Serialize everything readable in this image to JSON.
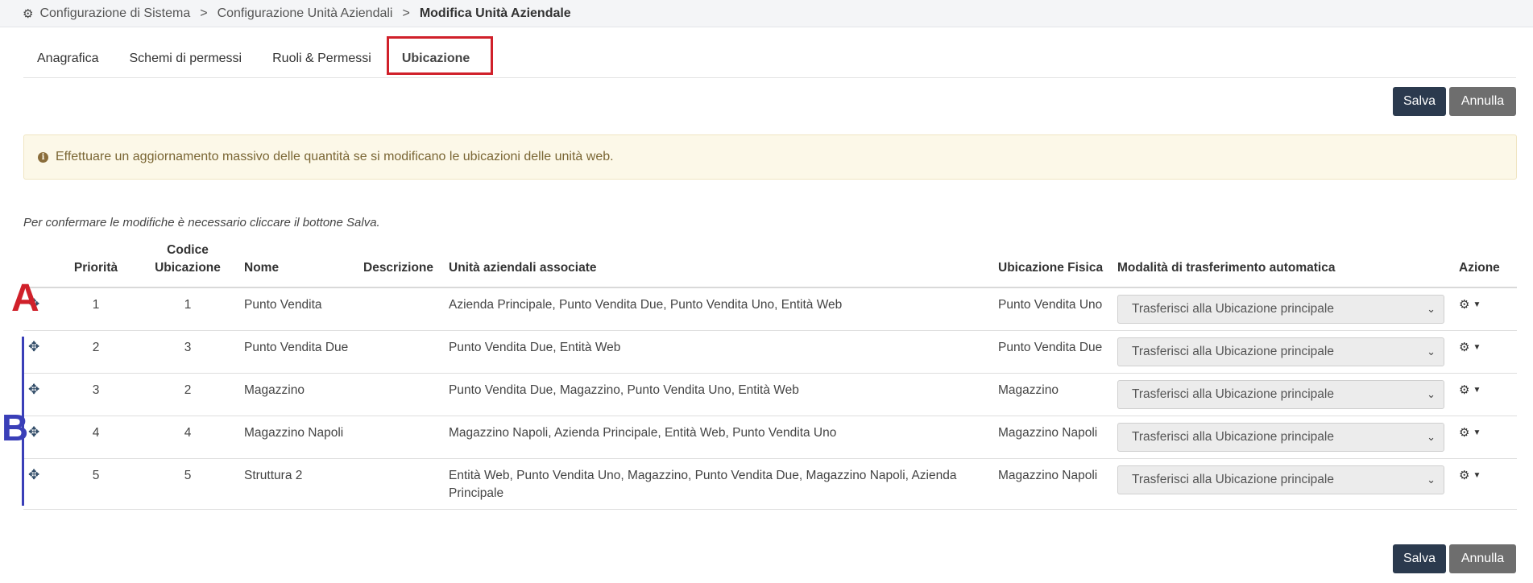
{
  "breadcrumb": {
    "icon": "cogs-icon",
    "items": [
      "Configurazione di Sistema",
      "Configurazione Unità Aziendali"
    ],
    "separator": ">",
    "current": "Modifica Unità Aziendale"
  },
  "tabs": [
    {
      "label": "Anagrafica",
      "active": false
    },
    {
      "label": "Schemi di permessi",
      "active": false
    },
    {
      "label": "Ruoli & Permessi",
      "active": false
    },
    {
      "label": "Ubicazione",
      "active": true
    }
  ],
  "buttons": {
    "save": "Salva",
    "cancel": "Annulla"
  },
  "alert": {
    "icon": "info-icon",
    "glyph": "i",
    "text": "Effettuare un aggiornamento massivo delle quantità se si modificano le ubicazioni delle unità web."
  },
  "note": "Per confermare le modifiche è necessario cliccare il bottone Salva.",
  "table": {
    "headers": {
      "priority": "Priorità",
      "code": "Codice Ubicazione",
      "name": "Nome",
      "description": "Descrizione",
      "units": "Unità aziendali associate",
      "physical": "Ubicazione Fisica",
      "mode": "Modalità di trasferimento automatica",
      "action": "Azione"
    },
    "rows": [
      {
        "priority": "1",
        "code": "1",
        "name": "Punto Vendita",
        "description": "",
        "units": "Azienda Principale, Punto Vendita Due, Punto Vendita Uno, Entità Web",
        "physical": "Punto Vendita Uno",
        "mode": "Trasferisci alla Ubicazione principale"
      },
      {
        "priority": "2",
        "code": "3",
        "name": "Punto Vendita Due",
        "description": "",
        "units": "Punto Vendita Due, Entità Web",
        "physical": "Punto Vendita Due",
        "mode": "Trasferisci alla Ubicazione principale"
      },
      {
        "priority": "3",
        "code": "2",
        "name": "Magazzino",
        "description": "",
        "units": "Punto Vendita Due, Magazzino, Punto Vendita Uno, Entità Web",
        "physical": "Magazzino",
        "mode": "Trasferisci alla Ubicazione principale"
      },
      {
        "priority": "4",
        "code": "4",
        "name": "Magazzino Napoli",
        "description": "",
        "units": "Magazzino Napoli, Azienda Principale, Entità Web, Punto Vendita Uno",
        "physical": "Magazzino Napoli",
        "mode": "Trasferisci alla Ubicazione principale"
      },
      {
        "priority": "5",
        "code": "5",
        "name": "Struttura 2",
        "description": "",
        "units": "Entità Web, Punto Vendita Uno, Magazzino, Punto Vendita Due, Magazzino Napoli, Azienda Principale",
        "physical": "Magazzino Napoli",
        "mode": "Trasferisci alla Ubicazione principale"
      }
    ]
  },
  "annotations": {
    "a": "A",
    "b": "B"
  },
  "colors": {
    "save": "#2b3a4e",
    "cancel": "#6e6e6e",
    "highlight": "#d0202a",
    "marker_b": "#3a3fb8"
  }
}
